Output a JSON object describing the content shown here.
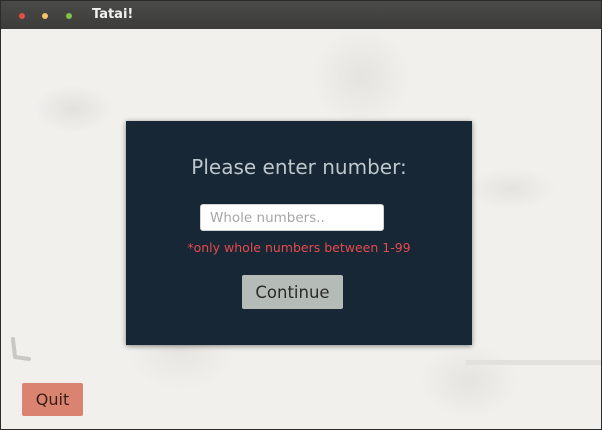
{
  "window": {
    "title": "Tatai!"
  },
  "dialog": {
    "heading": "Please enter number:",
    "input": {
      "value": "",
      "placeholder": "Whole numbers.."
    },
    "hint": "*only whole numbers between 1-99",
    "continue_label": "Continue"
  },
  "footer": {
    "quit_label": "Quit"
  },
  "colors": {
    "dialog_background": "#172735",
    "hint_text": "#e44b4b",
    "continue_button": "#b5bcb7",
    "quit_button": "#d98370"
  }
}
